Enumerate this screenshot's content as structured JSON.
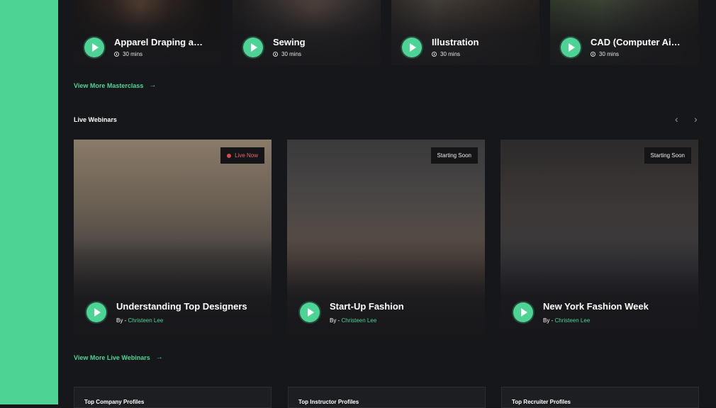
{
  "masterclass": {
    "cards": [
      {
        "title": "Apparel Draping and...",
        "duration": "30 mins"
      },
      {
        "title": "Sewing",
        "duration": "30 mins"
      },
      {
        "title": "Illustration",
        "duration": "30 mins"
      },
      {
        "title": "CAD (Computer Aided...",
        "duration": "30 mins"
      }
    ],
    "view_more": "View More Masterclass"
  },
  "webinars": {
    "section_title": "Live Webinars",
    "cards": [
      {
        "badge": "Live Now",
        "title": "Understanding Top Designers",
        "by_label": "By -",
        "author": "Christeen Lee"
      },
      {
        "badge": "Starting Soon",
        "title": "Start-Up Fashion",
        "by_label": "By -",
        "author": "Christeen Lee"
      },
      {
        "badge": "Starting Soon",
        "title": "New York Fashion Week",
        "by_label": "By -",
        "author": "Christeen Lee"
      }
    ],
    "view_more": "View More Live Webinars"
  },
  "profiles": [
    {
      "title": "Top Company Profiles"
    },
    {
      "title": "Top Instructor Profiles"
    },
    {
      "title": "Top Recruiter Profiles"
    }
  ],
  "colors": {
    "accent": "#4dd495",
    "background": "#16171b",
    "live": "#e24a4a"
  },
  "icons": [
    "play-icon",
    "clock-icon",
    "arrow-right-icon",
    "chevron-left-icon",
    "chevron-right-icon",
    "live-dot-icon"
  ]
}
